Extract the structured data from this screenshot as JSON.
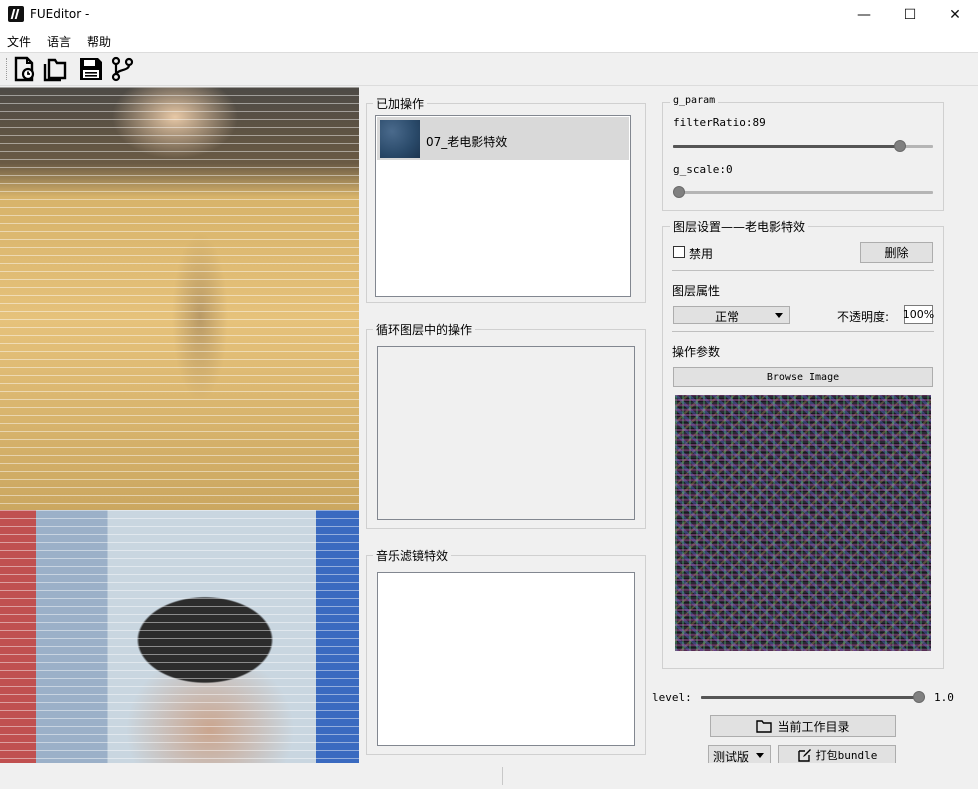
{
  "window": {
    "title": "FUEditor -",
    "minimize": "—",
    "maximize": "☐",
    "close": "✕"
  },
  "menu": [
    "文件",
    "语言",
    "帮助"
  ],
  "toolbar": {
    "icons": [
      "new-file-icon",
      "open-folder-icon",
      "save-icon",
      "branch-icon"
    ]
  },
  "middle": {
    "added_ops": {
      "title": "已加操作",
      "items": [
        {
          "label": "07_老电影特效"
        }
      ]
    },
    "loop_ops": {
      "title": "循环图层中的操作"
    },
    "music_filter": {
      "title": "音乐滤镜特效"
    }
  },
  "params": {
    "group_title": "g_param",
    "filter_ratio_label": "filterRatio:89",
    "filter_ratio_value": 89,
    "filter_ratio_max": 100,
    "g_scale_label": "g_scale:0",
    "g_scale_value": 0
  },
  "layer": {
    "group_title": "图层设置——老电影特效",
    "disable_label": "禁用",
    "disable_checked": false,
    "delete_button": "删除",
    "props_title": "图层属性",
    "blend_mode": "正常",
    "opacity_label": "不透明度:",
    "opacity_value": "100%",
    "op_params_title": "操作参数",
    "browse_button": "Browse Image"
  },
  "bottom": {
    "level_label": "level:",
    "level_value_text": "1.0",
    "level_fraction": 1.0,
    "workdir_button": "当前工作目录",
    "version_select": "测试版",
    "pack_button": "打包bundle"
  },
  "colors": {
    "slider_handle": "#808080",
    "button_bg": "#e1e1e1",
    "selected_item_bg": "#d9d9d9"
  }
}
